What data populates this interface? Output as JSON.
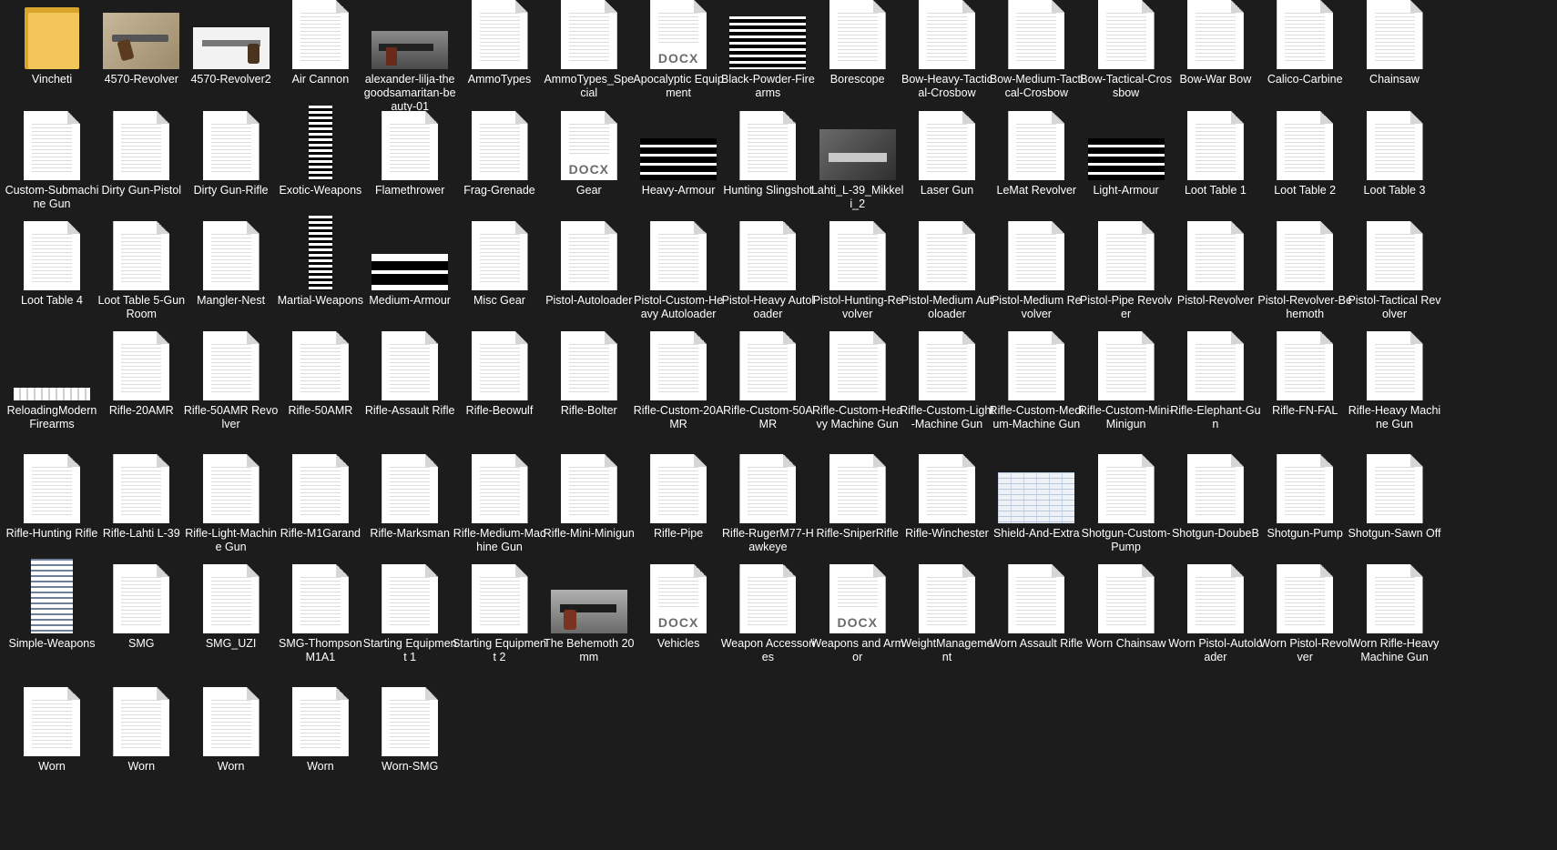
{
  "explorer": {
    "items": [
      {
        "label": "Vincheti",
        "type": "folder"
      },
      {
        "label": "4570-Revolver",
        "type": "image",
        "pic": "pic-revolver"
      },
      {
        "label": "4570-Revolver2",
        "type": "image",
        "pic": "pic-revolver2"
      },
      {
        "label": "Air Cannon",
        "type": "doc"
      },
      {
        "label": "alexander-lilja-thegoodsamaritan-beauty-01",
        "type": "image",
        "pic": "pic-dark-gun"
      },
      {
        "label": "AmmoTypes",
        "type": "doc"
      },
      {
        "label": "AmmoTypes_Special",
        "type": "doc"
      },
      {
        "label": "Apocalyptic Equipment",
        "type": "docx",
        "tag": "DOCX"
      },
      {
        "label": "Black-Powder-Firearms",
        "type": "image",
        "pic": "pic-bars"
      },
      {
        "label": "Borescope",
        "type": "doc"
      },
      {
        "label": "Bow-Heavy-Tactical-Crosbow",
        "type": "doc"
      },
      {
        "label": "Bow-Medium-Tactical-Crosbow",
        "type": "doc"
      },
      {
        "label": "Bow-Tactical-Crossbow",
        "type": "doc"
      },
      {
        "label": "Bow-War Bow",
        "type": "doc"
      },
      {
        "label": "Calico-Carbine",
        "type": "doc"
      },
      {
        "label": "Chainsaw",
        "type": "doc"
      },
      {
        "label": "Custom-Submachine Gun",
        "type": "doc"
      },
      {
        "label": "Dirty Gun-Pistol",
        "type": "doc"
      },
      {
        "label": "Dirty Gun-Rifle",
        "type": "doc"
      },
      {
        "label": "Exotic-Weapons",
        "type": "image",
        "pic": "pic-strip"
      },
      {
        "label": "Flamethrower",
        "type": "doc"
      },
      {
        "label": "Frag-Grenade",
        "type": "doc"
      },
      {
        "label": "Gear",
        "type": "docx",
        "tag": "DOCX"
      },
      {
        "label": "Heavy-Armour",
        "type": "image",
        "pic": "pic-bars-wide"
      },
      {
        "label": "Hunting Slingshot",
        "type": "doc"
      },
      {
        "label": "Lahti_L-39_Mikkeli_2",
        "type": "image",
        "pic": "pic-lahti"
      },
      {
        "label": "Laser Gun",
        "type": "doc"
      },
      {
        "label": "LeMat Revolver",
        "type": "doc"
      },
      {
        "label": "Light-Armour",
        "type": "image",
        "pic": "pic-bars-wide"
      },
      {
        "label": "Loot Table 1",
        "type": "doc"
      },
      {
        "label": "Loot Table 2",
        "type": "doc"
      },
      {
        "label": "Loot Table 3",
        "type": "doc"
      },
      {
        "label": "Loot Table 4",
        "type": "doc"
      },
      {
        "label": "Loot Table 5-Gun Room",
        "type": "doc"
      },
      {
        "label": "Mangler-Nest",
        "type": "doc"
      },
      {
        "label": "Martial-Weapons",
        "type": "image",
        "pic": "pic-strip"
      },
      {
        "label": "Medium-Armour",
        "type": "image",
        "pic": "pic-medium"
      },
      {
        "label": "Misc Gear",
        "type": "doc"
      },
      {
        "label": "Pistol-Autoloader",
        "type": "doc"
      },
      {
        "label": "Pistol-Custom-Heavy Autoloader",
        "type": "doc"
      },
      {
        "label": "Pistol-Heavy Autoloader",
        "type": "doc"
      },
      {
        "label": "Pistol-Hunting-Revolver",
        "type": "doc"
      },
      {
        "label": "Pistol-Medium Autoloader",
        "type": "doc"
      },
      {
        "label": "Pistol-Medium Revolver",
        "type": "doc"
      },
      {
        "label": "Pistol-Pipe Revolver",
        "type": "doc"
      },
      {
        "label": "Pistol-Revolver",
        "type": "doc"
      },
      {
        "label": "Pistol-Revolver-Behemoth",
        "type": "doc"
      },
      {
        "label": "Pistol-Tactical Revolver",
        "type": "doc"
      },
      {
        "label": "ReloadingModernFirearms",
        "type": "image",
        "pic": "pic-reload"
      },
      {
        "label": "Rifle-20AMR",
        "type": "doc"
      },
      {
        "label": "Rifle-50AMR Revolver",
        "type": "doc"
      },
      {
        "label": "Rifle-50AMR",
        "type": "doc"
      },
      {
        "label": "Rifle-Assault Rifle",
        "type": "doc"
      },
      {
        "label": "Rifle-Beowulf",
        "type": "doc"
      },
      {
        "label": "Rifle-Bolter",
        "type": "doc"
      },
      {
        "label": "Rifle-Custom-20AMR",
        "type": "doc"
      },
      {
        "label": "Rifle-Custom-50AMR",
        "type": "doc"
      },
      {
        "label": "Rifle-Custom-Heavy Machine Gun",
        "type": "doc"
      },
      {
        "label": "Rifle-Custom-Light-Machine Gun",
        "type": "doc"
      },
      {
        "label": "Rifle-Custom-Medium-Machine Gun",
        "type": "doc"
      },
      {
        "label": "Rifle-Custom-Mini-Minigun",
        "type": "doc"
      },
      {
        "label": "Rifle-Elephant-Gun",
        "type": "doc"
      },
      {
        "label": "Rifle-FN-FAL",
        "type": "doc"
      },
      {
        "label": "Rifle-Heavy Machine Gun",
        "type": "doc"
      },
      {
        "label": "Rifle-Hunting Rifle",
        "type": "doc"
      },
      {
        "label": "Rifle-Lahti L-39",
        "type": "doc"
      },
      {
        "label": "Rifle-Light-Machine Gun",
        "type": "doc"
      },
      {
        "label": "Rifle-M1Garand",
        "type": "doc"
      },
      {
        "label": "Rifle-Marksman",
        "type": "doc"
      },
      {
        "label": "Rifle-Medium-Machine Gun",
        "type": "doc"
      },
      {
        "label": "Rifle-Mini-Minigun",
        "type": "doc"
      },
      {
        "label": "Rifle-Pipe",
        "type": "doc"
      },
      {
        "label": "Rifle-RugerM77-Hawkeye",
        "type": "doc"
      },
      {
        "label": "Rifle-SniperRifle",
        "type": "doc"
      },
      {
        "label": "Rifle-Winchester",
        "type": "doc"
      },
      {
        "label": "Shield-And-Extra",
        "type": "image",
        "pic": "pic-shield"
      },
      {
        "label": "Shotgun-Custom-Pump",
        "type": "doc"
      },
      {
        "label": "Shotgun-DoubeB",
        "type": "doc"
      },
      {
        "label": "Shotgun-Pump",
        "type": "doc"
      },
      {
        "label": "Shotgun-Sawn Off",
        "type": "doc"
      },
      {
        "label": "Simple-Weapons",
        "type": "image",
        "pic": "pic-simple"
      },
      {
        "label": "SMG",
        "type": "doc"
      },
      {
        "label": "SMG_UZI",
        "type": "doc"
      },
      {
        "label": "SMG-Thompson M1A1",
        "type": "doc"
      },
      {
        "label": "Starting Equipment 1",
        "type": "doc"
      },
      {
        "label": "Starting Equipment 2",
        "type": "doc"
      },
      {
        "label": "The Behemoth 20mm",
        "type": "image",
        "pic": "pic-behemoth"
      },
      {
        "label": "Vehicles",
        "type": "docx",
        "tag": "DOCX"
      },
      {
        "label": "Weapon Accessories",
        "type": "doc"
      },
      {
        "label": "Weapons and Armor",
        "type": "docx",
        "tag": "DOCX"
      },
      {
        "label": "WeightManagement",
        "type": "doc"
      },
      {
        "label": "Worn Assault Rifle",
        "type": "doc"
      },
      {
        "label": "Worn Chainsaw",
        "type": "doc"
      },
      {
        "label": "Worn Pistol-Autoloader",
        "type": "doc"
      },
      {
        "label": "Worn Pistol-Revolver",
        "type": "doc"
      },
      {
        "label": "Worn Rifle-Heavy Machine Gun",
        "type": "doc"
      },
      {
        "label": "Worn",
        "type": "doc"
      },
      {
        "label": "Worn",
        "type": "doc"
      },
      {
        "label": "Worn",
        "type": "doc"
      },
      {
        "label": "Worn",
        "type": "doc"
      },
      {
        "label": "Worn-SMG",
        "type": "doc"
      }
    ]
  }
}
